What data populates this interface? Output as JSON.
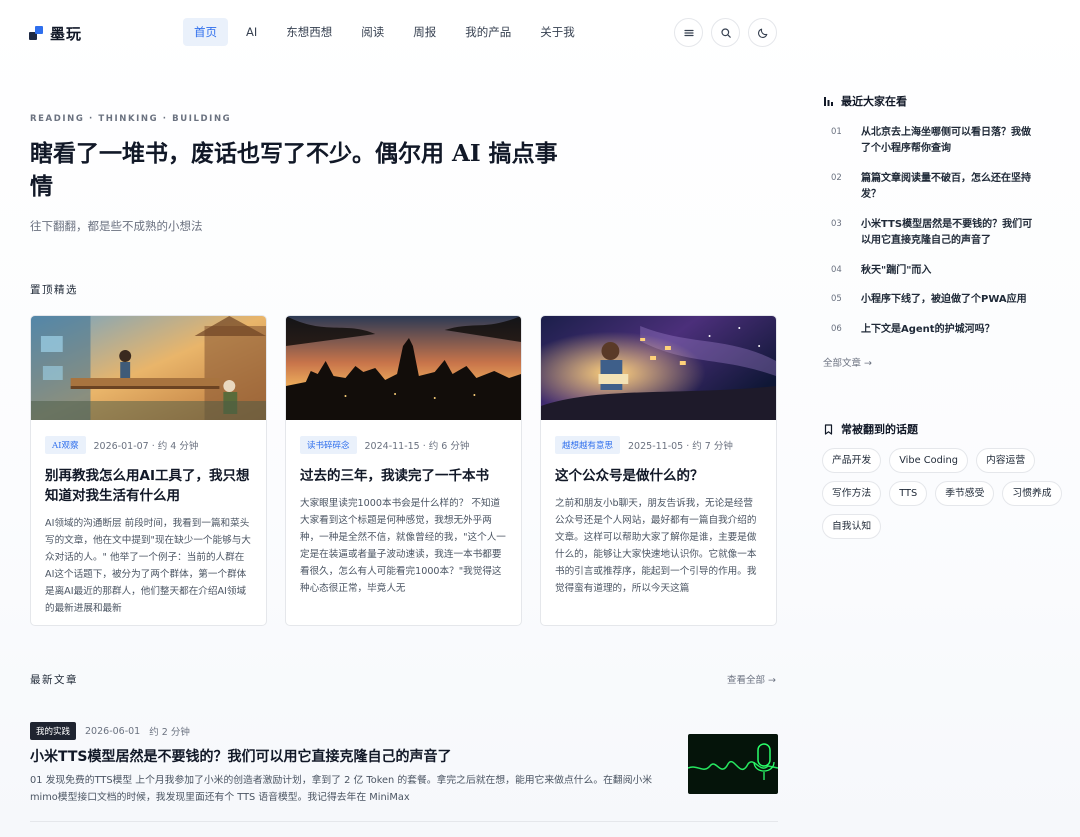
{
  "brand": {
    "name": "墨玩"
  },
  "nav": [
    "首页",
    "AI",
    "东想西想",
    "阅读",
    "周报",
    "我的产品",
    "关于我"
  ],
  "hero": {
    "eyebrow": "READING · THINKING · BUILDING",
    "title": "瞎看了一堆书，废话也写了不少。偶尔用 AI 搞点事情",
    "subtitle": "往下翻翻，都是些不成熟的小想法"
  },
  "pinned": {
    "label": "置顶精选",
    "cards": [
      {
        "badge": "AI观察",
        "meta": "2026-01-07 · 约 4 分钟",
        "title": "别再教我怎么用AI工具了，我只想知道对我生活有什么用",
        "excerpt": "AI领域的沟通断层 前段时间，我看到一篇和菜头写的文章，他在文中提到\"现在缺少一个能够与大众对话的人。\" 他举了一个例子：当前的人群在AI这个话题下，被分为了两个群体，第一个群体是离AI最近的那群人，他们整天都在介绍AI领域的最新进展和最新"
      },
      {
        "badge": "读书碎碎念",
        "meta": "2024-11-15 · 约 6 分钟",
        "title": "过去的三年，我读完了一千本书",
        "excerpt": "大家眼里读完1000本书会是什么样的？ 不知道大家看到这个标题是何种感觉，我想无外乎两种，一种是全然不信，就像曾经的我，\"这个人一定是在装逼或者量子波动速读，我连一本书都要看很久，怎么有人可能看完1000本？\"我觉得这种心态很正常，毕竟人无"
      },
      {
        "badge": "越想越有意思",
        "meta": "2025-11-05 · 约 7 分钟",
        "title": "这个公众号是做什么的？",
        "excerpt": "之前和朋友小b聊天，朋友告诉我，无论是经营公众号还是个人网站，最好都有一篇自我介绍的文章。这样可以帮助大家了解你是谁，主要是做什么的，能够让大家快速地认识你。它就像一本书的引言或推荐序，能起到一个引导的作用。我觉得蛮有道理的，所以今天这篇"
      }
    ]
  },
  "latest": {
    "label": "最新文章",
    "view_all": "查看全部 →",
    "items": [
      {
        "tag": "我的实践",
        "date": "2026-06-01",
        "read": "约 2 分钟",
        "title": "小米TTS模型居然是不要钱的？我们可以用它直接克隆自己的声音了",
        "excerpt": "01 发现免费的TTS模型 上个月我参加了小米的创造者激励计划，拿到了 2 亿 Token 的套餐。拿完之后就在想，能用它来做点什么。在翻阅小米mimo模型接口文档的时候，我发现里面还有个 TTS 语音模型。我记得去年在 MiniMax"
      }
    ]
  },
  "sidebar": {
    "trending_title": "最近大家在看",
    "trending": [
      {
        "no": "01",
        "title": "从北京去上海坐哪侧可以看日落？我做了个小程序帮你查询"
      },
      {
        "no": "02",
        "title": "篇篇文章阅读量不破百，怎么还在坚持发？"
      },
      {
        "no": "03",
        "title": "小米TTS模型居然是不要钱的？我们可以用它直接克隆自己的声音了"
      },
      {
        "no": "04",
        "title": "秋天\"踹门\"而入"
      },
      {
        "no": "05",
        "title": "小程序下线了，被迫做了个PWA应用"
      },
      {
        "no": "06",
        "title": "上下文是Agent的护城河吗？"
      }
    ],
    "all_posts": "全部文章 →",
    "topics_title": "常被翻到的话题",
    "topics": [
      "产品开发",
      "Vibe Coding",
      "内容运营",
      "写作方法",
      "TTS",
      "季节感受",
      "习惯养成",
      "自我认知"
    ]
  },
  "colors": {
    "accent": "#2f6fed",
    "badge_bg": "#eaf1fb",
    "dark_tag": "#1f2430"
  },
  "icons": [
    "menu-icon",
    "search-icon",
    "moon-icon",
    "bar-chart-icon",
    "bookmark-icon"
  ]
}
